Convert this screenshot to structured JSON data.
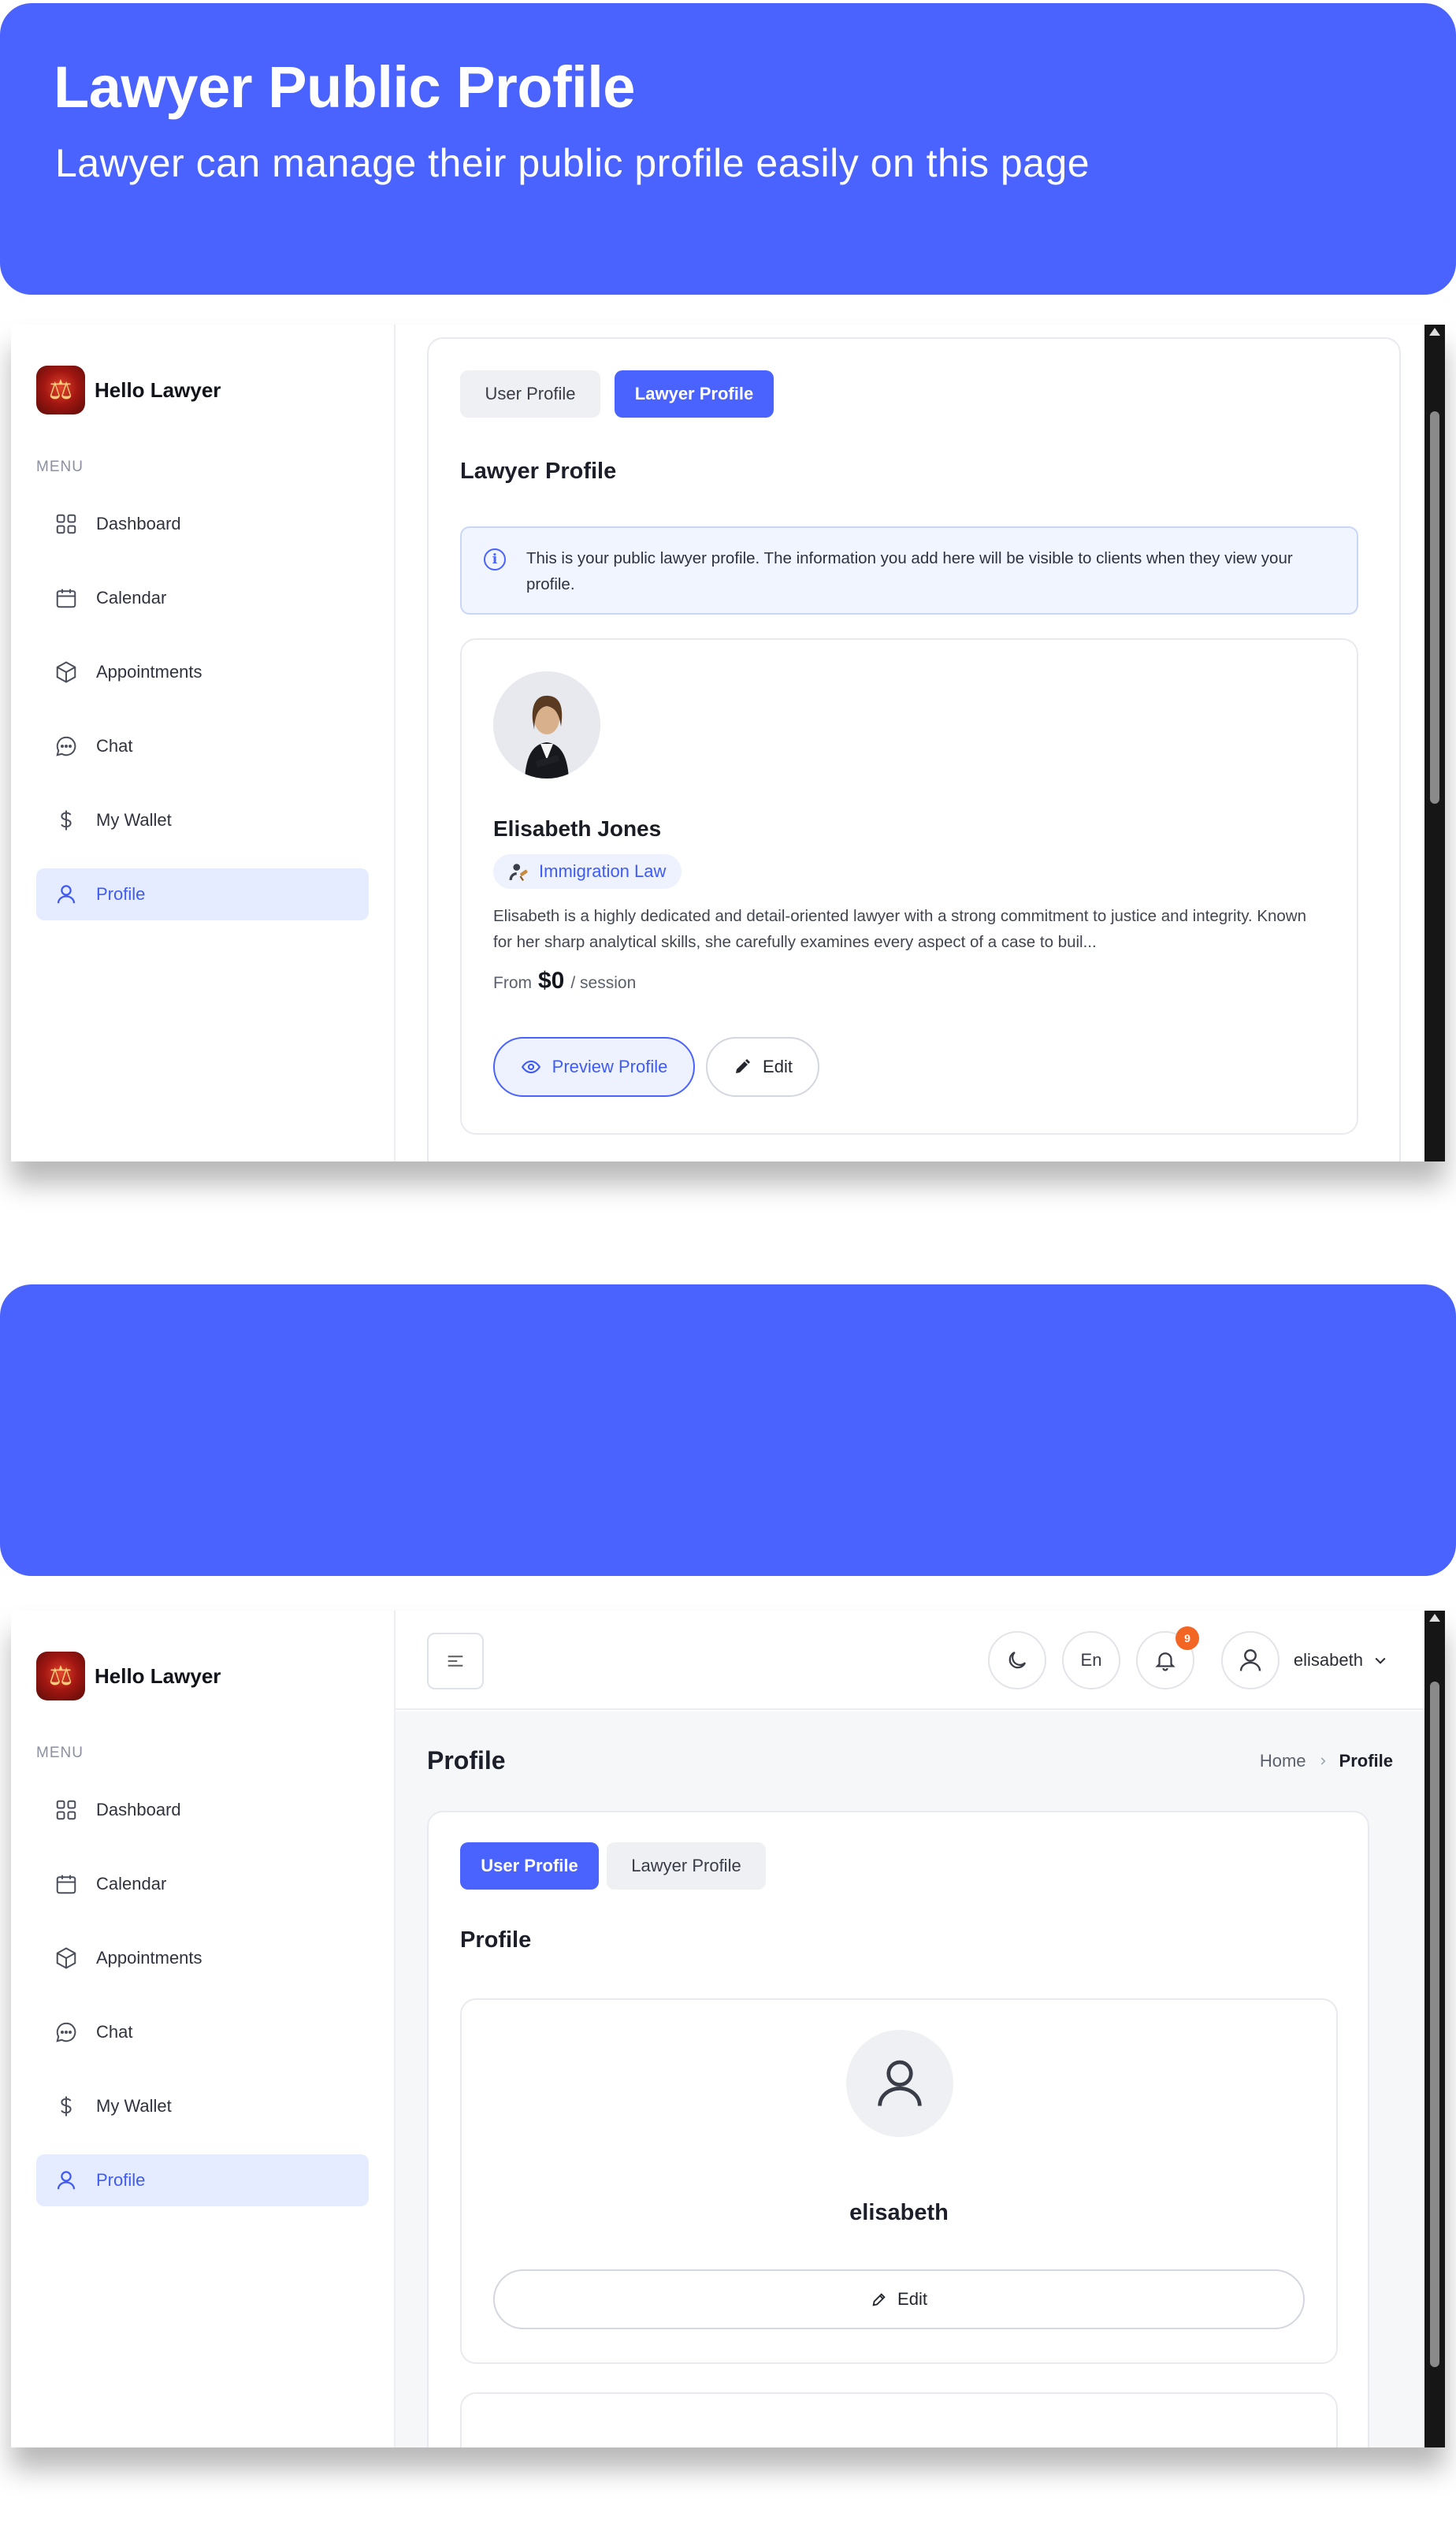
{
  "banner1": {
    "title": "Lawyer Public Profile",
    "subtitle": "Lawyer can manage their public profile easily on this page"
  },
  "banner2": {
    "title": "",
    "subtitle": ""
  },
  "brand": {
    "name": "Hello Lawyer",
    "logo_icon": "scales-of-justice-logo"
  },
  "sidebar": {
    "menu_label": "MENU",
    "items": [
      {
        "label": "Dashboard",
        "icon": "grid-icon",
        "active": false
      },
      {
        "label": "Calendar",
        "icon": "calendar-icon",
        "active": false
      },
      {
        "label": "Appointments",
        "icon": "box-icon",
        "active": false
      },
      {
        "label": "Chat",
        "icon": "chat-bubble-icon",
        "active": false
      },
      {
        "label": "My Wallet",
        "icon": "dollar-icon",
        "active": false
      },
      {
        "label": "Profile",
        "icon": "user-icon",
        "active": true
      }
    ]
  },
  "shot1": {
    "tabs": {
      "user": "User Profile",
      "lawyer": "Lawyer Profile",
      "active": "lawyer"
    },
    "section_title": "Lawyer Profile",
    "info_text": "This is your public lawyer profile. The information you add here will be visible to clients when they view your profile.",
    "lawyer": {
      "name": "Elisabeth Jones",
      "specialty": "Immigration Law",
      "bio": "Elisabeth is a highly dedicated and detail-oriented lawyer with a strong commitment to justice and integrity. Known for her sharp analytical skills, she carefully examines every aspect of a case to buil...",
      "price_from": "From",
      "price_amount": "$0",
      "price_unit": "/ session"
    },
    "buttons": {
      "preview": "Preview Profile",
      "edit": "Edit"
    }
  },
  "shot2": {
    "topbar": {
      "lang": "En",
      "notification_count": "9",
      "username": "elisabeth"
    },
    "page_title": "Profile",
    "breadcrumb": {
      "home": "Home",
      "current": "Profile"
    },
    "tabs": {
      "user": "User Profile",
      "lawyer": "Lawyer Profile",
      "active": "user"
    },
    "section_title": "Profile",
    "user": {
      "name": "elisabeth"
    },
    "buttons": {
      "edit": "Edit"
    }
  },
  "colors": {
    "accent": "#4a63ff",
    "active_bg": "#e6ecff",
    "badge": "#f26522"
  }
}
